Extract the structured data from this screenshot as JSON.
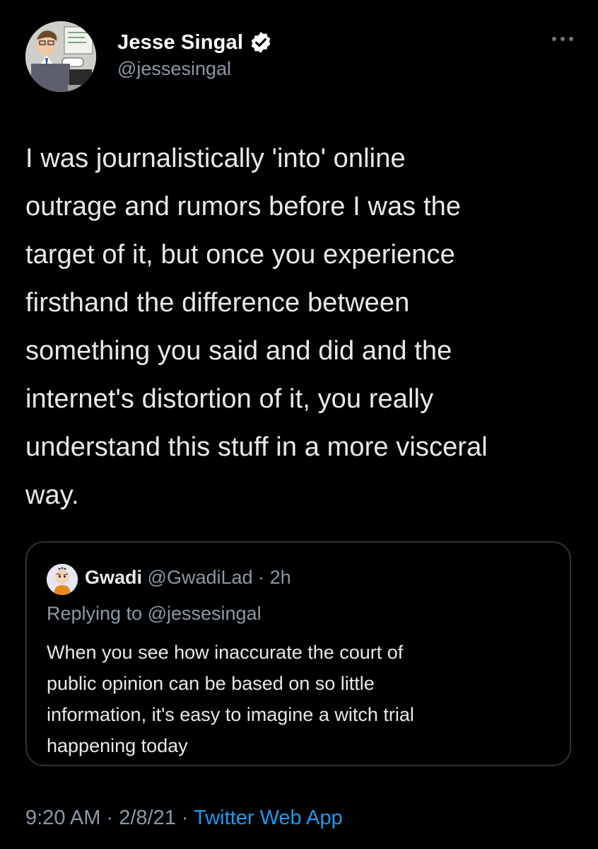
{
  "author": {
    "name": "Jesse Singal",
    "handle": "@jessesingal",
    "verified_icon": "verified-badge-icon",
    "avatar_icon": "cartoon-avatar"
  },
  "tweet": {
    "text": "I was journalistically 'into' online\noutrage and rumors before I was the\ntarget of it, but once you experience\nfirsthand the difference between\nsomething you said and did and the\ninternet's distortion of it, you really\nunderstand this stuff in a more visceral\nway."
  },
  "quoted_tweet": {
    "name": "Gwadi",
    "handle": "@GwadiLad",
    "separator": "·",
    "time": "2h",
    "replying_to": "Replying to @jessesingal",
    "text": "When you see how inaccurate the court of\npublic opinion can be based on so little\ninformation, it's easy to imagine a witch trial\nhappening today"
  },
  "meta": {
    "time": "9:20 AM",
    "separator": "·",
    "date": "2/8/21",
    "source": "Twitter Web App"
  },
  "colors": {
    "background": "#000000",
    "text_primary": "#e7e9ea",
    "text_secondary": "#8b98a5",
    "accent": "#1d9bf0",
    "border": "#2f3336"
  }
}
